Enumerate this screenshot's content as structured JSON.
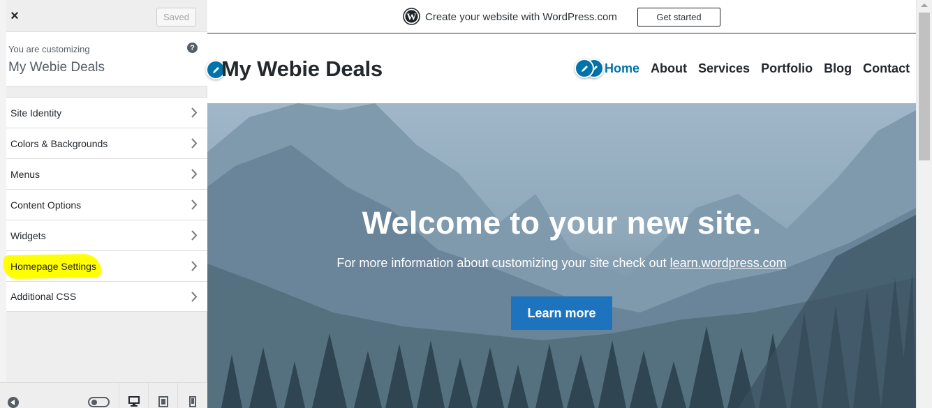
{
  "sidebar": {
    "close_label": "×",
    "saved_label": "Saved",
    "customizing_label": "You are customizing",
    "site_name": "My Webie Deals",
    "items": [
      {
        "label": "Site Identity"
      },
      {
        "label": "Colors & Backgrounds"
      },
      {
        "label": "Menus"
      },
      {
        "label": "Content Options"
      },
      {
        "label": "Widgets"
      },
      {
        "label": "Homepage Settings",
        "highlighted": true
      },
      {
        "label": "Additional CSS"
      }
    ]
  },
  "preview": {
    "banner_text": "Create your website with WordPress.com",
    "banner_button": "Get started",
    "site_title": "My Webie Deals",
    "nav": [
      "Home",
      "About",
      "Services",
      "Portfolio",
      "Blog",
      "Contact"
    ],
    "active_nav": "Home",
    "hero_title": "Welcome to your new site.",
    "hero_sub_prefix": "For more information about customizing your site check out",
    "hero_link": "learn.wordpress.com",
    "hero_button": "Learn more"
  },
  "colors": {
    "accent": "#0073aa",
    "button": "#1e73be",
    "highlight": "#ffff00"
  },
  "icons": [
    "close-icon",
    "help-icon",
    "chevron-right-icon",
    "collapse-icon",
    "toggle-icon",
    "desktop-icon",
    "tablet-icon",
    "mobile-icon",
    "wordpress-logo-icon",
    "edit-pencil-icon"
  ]
}
